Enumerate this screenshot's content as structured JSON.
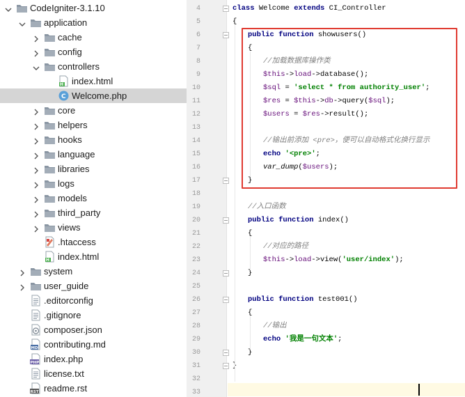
{
  "project_tree": {
    "items": [
      {
        "label": "CodeIgniter-3.1.10",
        "arrow": "down",
        "icon": "folder",
        "level": 0
      },
      {
        "label": "application",
        "arrow": "down",
        "icon": "folder",
        "level": 1
      },
      {
        "label": "cache",
        "arrow": "right",
        "icon": "folder",
        "level": 2
      },
      {
        "label": "config",
        "arrow": "right",
        "icon": "folder",
        "level": 2
      },
      {
        "label": "controllers",
        "arrow": "down",
        "icon": "folder",
        "level": 2
      },
      {
        "label": "index.html",
        "arrow": "none",
        "icon": "html",
        "level": 3
      },
      {
        "label": "Welcome.php",
        "arrow": "none",
        "icon": "php-class",
        "level": 3,
        "selected": true
      },
      {
        "label": "core",
        "arrow": "right",
        "icon": "folder",
        "level": 2
      },
      {
        "label": "helpers",
        "arrow": "right",
        "icon": "folder",
        "level": 2
      },
      {
        "label": "hooks",
        "arrow": "right",
        "icon": "folder",
        "level": 2
      },
      {
        "label": "language",
        "arrow": "right",
        "icon": "folder",
        "level": 2
      },
      {
        "label": "libraries",
        "arrow": "right",
        "icon": "folder",
        "level": 2
      },
      {
        "label": "logs",
        "arrow": "right",
        "icon": "folder",
        "level": 2
      },
      {
        "label": "models",
        "arrow": "right",
        "icon": "folder",
        "level": 2
      },
      {
        "label": "third_party",
        "arrow": "right",
        "icon": "folder",
        "level": 2
      },
      {
        "label": "views",
        "arrow": "right",
        "icon": "folder",
        "level": 2
      },
      {
        "label": ".htaccess",
        "arrow": "none",
        "icon": "htaccess",
        "level": 2
      },
      {
        "label": "index.html",
        "arrow": "none",
        "icon": "html",
        "level": 2
      },
      {
        "label": "system",
        "arrow": "right",
        "icon": "folder",
        "level": 1
      },
      {
        "label": "user_guide",
        "arrow": "right",
        "icon": "folder",
        "level": 1
      },
      {
        "label": ".editorconfig",
        "arrow": "none",
        "icon": "text",
        "level": 1
      },
      {
        "label": ".gitignore",
        "arrow": "none",
        "icon": "text",
        "level": 1
      },
      {
        "label": "composer.json",
        "arrow": "none",
        "icon": "json",
        "level": 1
      },
      {
        "label": "contributing.md",
        "arrow": "none",
        "icon": "md",
        "level": 1
      },
      {
        "label": "index.php",
        "arrow": "none",
        "icon": "php",
        "level": 1
      },
      {
        "label": "license.txt",
        "arrow": "none",
        "icon": "text",
        "level": 1
      },
      {
        "label": "readme.rst",
        "arrow": "none",
        "icon": "rst",
        "level": 1
      }
    ]
  },
  "editor": {
    "lines": [
      {
        "num": "4",
        "fold": true,
        "tokens": [
          [
            "kw",
            "class "
          ],
          [
            "",
            "Welcome "
          ],
          [
            "kw",
            "extends "
          ],
          [
            "",
            "CI_Controller"
          ]
        ],
        "indent": 0
      },
      {
        "num": "5",
        "fold": false,
        "tokens": [
          [
            "",
            "{"
          ]
        ],
        "indent": 0
      },
      {
        "num": "6",
        "fold": true,
        "tokens": [
          [
            "kw",
            "public function "
          ],
          [
            "",
            "showusers()"
          ]
        ],
        "indent": 1
      },
      {
        "num": "7",
        "fold": false,
        "tokens": [
          [
            "",
            "{"
          ]
        ],
        "indent": 1
      },
      {
        "num": "8",
        "fold": false,
        "tokens": [
          [
            "cmt",
            "//加载数据库操作类"
          ]
        ],
        "indent": 2
      },
      {
        "num": "9",
        "fold": false,
        "tokens": [
          [
            "var",
            "$this"
          ],
          [
            "",
            "->"
          ],
          [
            "var",
            "load"
          ],
          [
            "",
            "->database();"
          ]
        ],
        "indent": 2
      },
      {
        "num": "10",
        "fold": false,
        "tokens": [
          [
            "var",
            "$sql"
          ],
          [
            "",
            " = "
          ],
          [
            "str",
            "'select * from authority_user'"
          ],
          [
            "",
            ";"
          ]
        ],
        "indent": 2
      },
      {
        "num": "11",
        "fold": false,
        "tokens": [
          [
            "var",
            "$res"
          ],
          [
            "",
            " = "
          ],
          [
            "var",
            "$this"
          ],
          [
            "",
            "->"
          ],
          [
            "var",
            "db"
          ],
          [
            "",
            "->query("
          ],
          [
            "var",
            "$sql"
          ],
          [
            "",
            ");"
          ]
        ],
        "indent": 2
      },
      {
        "num": "12",
        "fold": false,
        "tokens": [
          [
            "var",
            "$users"
          ],
          [
            "",
            " = "
          ],
          [
            "var",
            "$res"
          ],
          [
            "",
            "->"
          ],
          [
            "",
            "result();"
          ]
        ],
        "indent": 2
      },
      {
        "num": "13",
        "fold": false,
        "tokens": [],
        "indent": 0
      },
      {
        "num": "14",
        "fold": false,
        "tokens": [
          [
            "cmt",
            "//输出前添加 <pre>，便可以自动格式化换行显示"
          ]
        ],
        "indent": 2
      },
      {
        "num": "15",
        "fold": false,
        "tokens": [
          [
            "kw",
            "echo "
          ],
          [
            "str",
            "'<pre>'"
          ],
          [
            "",
            ";"
          ]
        ],
        "indent": 2
      },
      {
        "num": "16",
        "fold": false,
        "tokens": [
          [
            "ital",
            "var_dump"
          ],
          [
            "",
            "("
          ],
          [
            "var",
            "$users"
          ],
          [
            "",
            ");"
          ]
        ],
        "indent": 2
      },
      {
        "num": "17",
        "fold": true,
        "tokens": [
          [
            "",
            "}"
          ]
        ],
        "indent": 1
      },
      {
        "num": "18",
        "fold": false,
        "tokens": [],
        "indent": 0
      },
      {
        "num": "19",
        "fold": false,
        "tokens": [
          [
            "cmt",
            "//入口函数"
          ]
        ],
        "indent": 1
      },
      {
        "num": "20",
        "fold": true,
        "tokens": [
          [
            "kw",
            "public function "
          ],
          [
            "",
            "index()"
          ]
        ],
        "indent": 1
      },
      {
        "num": "21",
        "fold": false,
        "tokens": [
          [
            "",
            "{"
          ]
        ],
        "indent": 1
      },
      {
        "num": "22",
        "fold": false,
        "tokens": [
          [
            "cmt",
            "//对应的路径"
          ]
        ],
        "indent": 2
      },
      {
        "num": "23",
        "fold": false,
        "tokens": [
          [
            "var",
            "$this"
          ],
          [
            "",
            "->"
          ],
          [
            "var",
            "load"
          ],
          [
            "",
            "->view("
          ],
          [
            "str",
            "'user/index'"
          ],
          [
            "",
            ");"
          ]
        ],
        "indent": 2
      },
      {
        "num": "24",
        "fold": true,
        "tokens": [
          [
            "",
            "}"
          ]
        ],
        "indent": 1
      },
      {
        "num": "25",
        "fold": false,
        "tokens": [],
        "indent": 0
      },
      {
        "num": "26",
        "fold": true,
        "tokens": [
          [
            "kw",
            "public function "
          ],
          [
            "",
            "test001()"
          ]
        ],
        "indent": 1
      },
      {
        "num": "27",
        "fold": false,
        "tokens": [
          [
            "",
            "{"
          ]
        ],
        "indent": 1
      },
      {
        "num": "28",
        "fold": false,
        "tokens": [
          [
            "cmt",
            "//输出"
          ]
        ],
        "indent": 2
      },
      {
        "num": "29",
        "fold": false,
        "tokens": [
          [
            "kw",
            "echo "
          ],
          [
            "str",
            "'我是一句文本'"
          ],
          [
            "",
            ";"
          ]
        ],
        "indent": 2
      },
      {
        "num": "30",
        "fold": true,
        "tokens": [
          [
            "",
            "}"
          ]
        ],
        "indent": 1
      },
      {
        "num": "31",
        "fold": true,
        "tokens": [
          [
            "",
            "}"
          ]
        ],
        "indent": 0
      },
      {
        "num": "32",
        "fold": false,
        "tokens": [],
        "indent": 0
      },
      {
        "num": "33",
        "fold": false,
        "tokens": [],
        "indent": 0
      }
    ]
  },
  "colors": {
    "keyword": "#000080",
    "string": "#008000",
    "variable": "#660e7a",
    "comment": "#808080",
    "selection_row": "#d5d5d5",
    "highlight_box": "#e03a30",
    "folder": "#8a96a3"
  }
}
